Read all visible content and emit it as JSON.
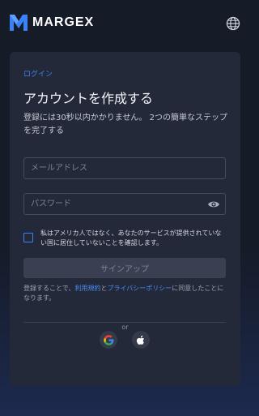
{
  "brand": {
    "name": "MARGEX"
  },
  "icons": {
    "logo": "margex-logo-icon",
    "globe": "globe-icon",
    "eye": "eye-icon",
    "google": "google-icon",
    "apple": "apple-icon"
  },
  "colors": {
    "accent": "#3b82f6",
    "card": "#232938",
    "background": "#161b28"
  },
  "form": {
    "breadcrumb": "ログイン",
    "title": "アカウントを作成する",
    "subtitle": "登録には30秒以内かかりません。 2つの簡単なステップを完了する",
    "email_placeholder": "メールアドレス",
    "password_placeholder": "パスワード",
    "checkbox_label": "私はアメリカ人ではなく、あなたのサービスが提供されていない国に居住していないことを確認します。",
    "submit_label": "サインアップ",
    "terms_prefix": "登録することで、",
    "terms_link1": "利用規約",
    "terms_and": "と",
    "terms_link2": "プライバシーポリシー",
    "terms_suffix": "に同意したことになります。",
    "or_label": "or"
  }
}
